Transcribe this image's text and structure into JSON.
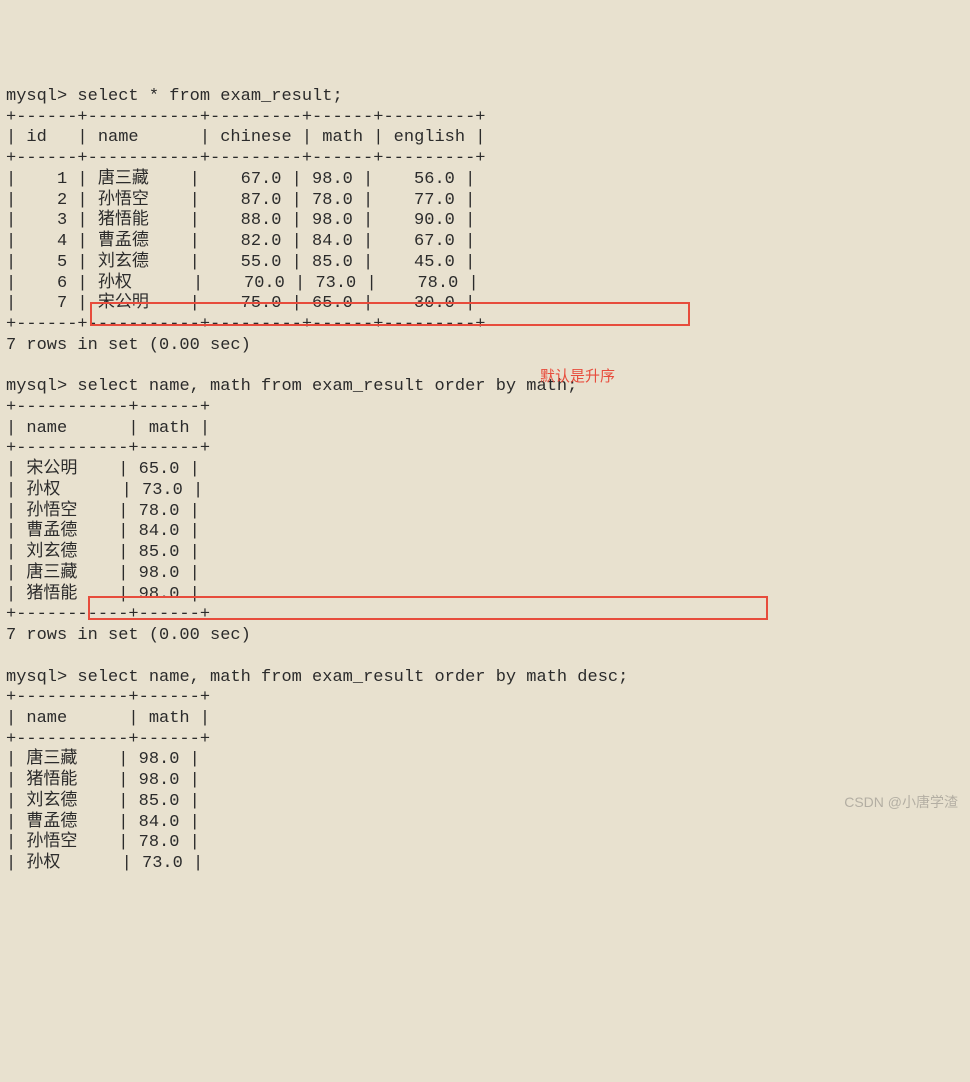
{
  "prompt": "mysql>",
  "query1": {
    "sql": "select * from exam_result;",
    "border_top": "+------+-----------+---------+------+---------+",
    "header": "| id   | name      | chinese | math | english |",
    "border_mid": "+------+-----------+---------+------+---------+",
    "rows": [
      "|    1 | 唐三藏    |    67.0 | 98.0 |    56.0 |",
      "|    2 | 孙悟空    |    87.0 | 78.0 |    77.0 |",
      "|    3 | 猪悟能    |    88.0 | 98.0 |    90.0 |",
      "|    4 | 曹孟德    |    82.0 | 84.0 |    67.0 |",
      "|    5 | 刘玄德    |    55.0 | 85.0 |    45.0 |",
      "|    6 | 孙权      |    70.0 | 73.0 |    78.0 |",
      "|    7 | 宋公明    |    75.0 | 65.0 |    30.0 |"
    ],
    "border_bot": "+------+-----------+---------+------+---------+",
    "status": "7 rows in set (0.00 sec)"
  },
  "query2": {
    "sql": "select name, math from exam_result order by math;",
    "border_top": "+-----------+------+",
    "header": "| name      | math |",
    "border_mid": "+-----------+------+",
    "rows": [
      "| 宋公明    | 65.0 |",
      "| 孙权      | 73.0 |",
      "| 孙悟空    | 78.0 |",
      "| 曹孟德    | 84.0 |",
      "| 刘玄德    | 85.0 |",
      "| 唐三藏    | 98.0 |",
      "| 猪悟能    | 98.0 |"
    ],
    "border_bot": "+-----------+------+",
    "status": "7 rows in set (0.00 sec)"
  },
  "query3": {
    "sql": "select name, math from exam_result order by math desc;",
    "border_top": "+-----------+------+",
    "header": "| name      | math |",
    "border_mid": "+-----------+------+",
    "rows": [
      "| 唐三藏    | 98.0 |",
      "| 猪悟能    | 98.0 |",
      "| 刘玄德    | 85.0 |",
      "| 曹孟德    | 84.0 |",
      "| 孙悟空    | 78.0 |",
      "| 孙权      | 73.0 |"
    ]
  },
  "annotation": "默认是升序",
  "watermark": "CSDN @小唐学渣",
  "chart_data": {
    "type": "table",
    "tables": [
      {
        "name": "exam_result_full",
        "columns": [
          "id",
          "name",
          "chinese",
          "math",
          "english"
        ],
        "rows": [
          [
            1,
            "唐三藏",
            67.0,
            98.0,
            56.0
          ],
          [
            2,
            "孙悟空",
            87.0,
            78.0,
            77.0
          ],
          [
            3,
            "猪悟能",
            88.0,
            98.0,
            90.0
          ],
          [
            4,
            "曹孟德",
            82.0,
            84.0,
            67.0
          ],
          [
            5,
            "刘玄德",
            55.0,
            85.0,
            45.0
          ],
          [
            6,
            "孙权",
            70.0,
            73.0,
            78.0
          ],
          [
            7,
            "宋公明",
            75.0,
            65.0,
            30.0
          ]
        ]
      },
      {
        "name": "order_by_math_asc",
        "columns": [
          "name",
          "math"
        ],
        "rows": [
          [
            "宋公明",
            65.0
          ],
          [
            "孙权",
            73.0
          ],
          [
            "孙悟空",
            78.0
          ],
          [
            "曹孟德",
            84.0
          ],
          [
            "刘玄德",
            85.0
          ],
          [
            "唐三藏",
            98.0
          ],
          [
            "猪悟能",
            98.0
          ]
        ]
      },
      {
        "name": "order_by_math_desc",
        "columns": [
          "name",
          "math"
        ],
        "rows": [
          [
            "唐三藏",
            98.0
          ],
          [
            "猪悟能",
            98.0
          ],
          [
            "刘玄德",
            85.0
          ],
          [
            "曹孟德",
            84.0
          ],
          [
            "孙悟空",
            78.0
          ],
          [
            "孙权",
            73.0
          ]
        ]
      }
    ]
  }
}
